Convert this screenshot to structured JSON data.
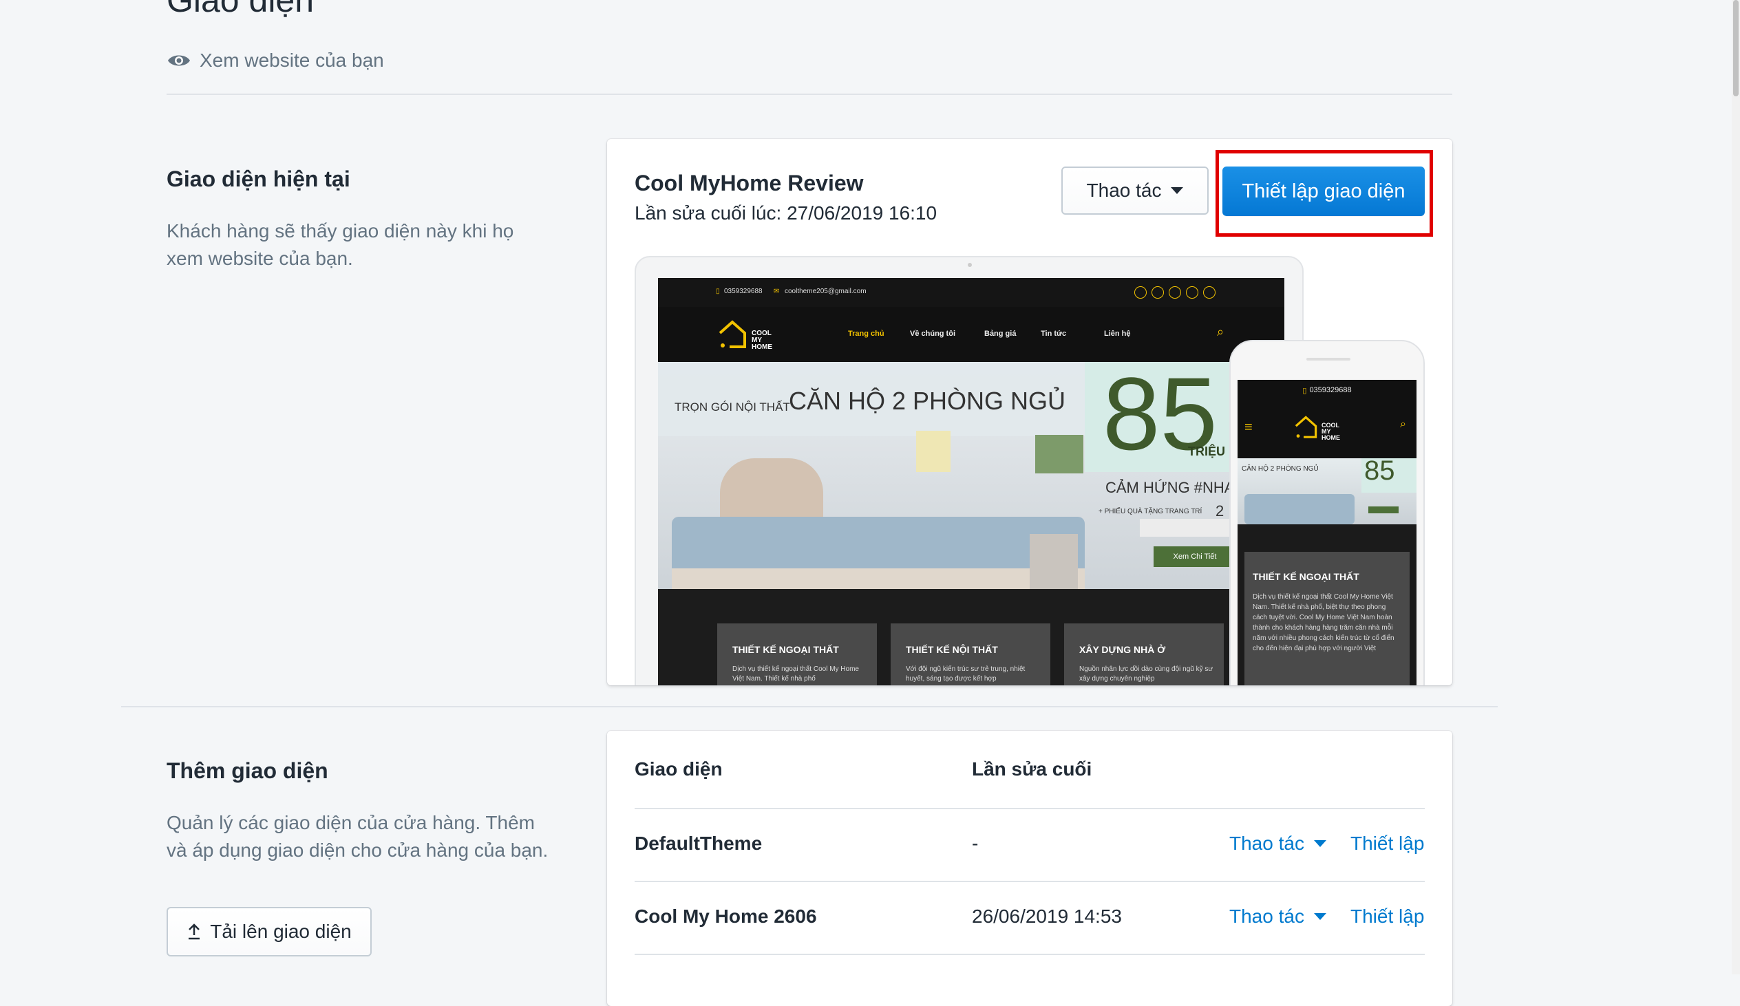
{
  "header": {
    "title": "Giao diện",
    "view_link": "Xem website của bạn",
    "view_icon": "eye-icon"
  },
  "current_section": {
    "title": "Giao diện hiện tại",
    "description": "Khách hàng sẽ thấy giao diện này khi họ xem website của bạn."
  },
  "current_theme": {
    "name": "Cool MyHome Review",
    "last_edited": "Lần sửa cuối lúc: 27/06/2019 16:10",
    "actions_label": "Thao tác",
    "setup_label": "Thiết lập giao diện"
  },
  "preview": {
    "phone": "0359329688",
    "email": "cooltheme205@gmail.com",
    "brand": "COOL MY HOME",
    "nav": [
      "Trang chủ",
      "Về chúng tôi",
      "Bảng giá",
      "Tin tức",
      "Liên hệ"
    ],
    "hero_small": "TRỌN GÓI NỘI THẤT",
    "hero_big": "CĂN HỘ 2 PHÒNG NGỦ",
    "price": "85",
    "price_unit": "TRIỆU",
    "hero_tag": "CẢM HỨNG #NHA",
    "hero_note": "+ PHIẾU QUÀ TẶNG TRANG TRÍ",
    "hero_note_num": "2",
    "cta": "Xem Chi Tiết",
    "tiles": [
      {
        "title": "THIẾT KẾ NGOẠI THẤT",
        "text": "Dịch vụ thiết kế ngoại thất Cool My Home Việt Nam. Thiết kế nhà phố"
      },
      {
        "title": "THIẾT KẾ NỘI THẤT",
        "text": "Với đội ngũ kiến trúc sư trẻ trung, nhiệt huyết, sáng tạo được kết hợp"
      },
      {
        "title": "XÂY DỰNG NHÀ Ở",
        "text": "Nguồn nhân lực dồi dào cùng đội ngũ kỹ sư xây dựng chuyên nghiệp"
      }
    ],
    "mobile_card_title": "THIẾT KẾ NGOẠI THẤT",
    "mobile_card_text": "Dịch vụ thiết kế ngoại thất Cool My Home Việt Nam. Thiết kế nhà phố, biệt thự theo phong cách tuyệt vời. Cool My Home Việt Nam hoàn thành cho khách hàng hàng trăm căn nhà mỗi năm với nhiều phong cách kiến trúc từ cổ điển cho đến hiện đại phù hợp với người Việt"
  },
  "add_section": {
    "title": "Thêm giao diện",
    "description": "Quản lý các giao diện của cửa hàng. Thêm và áp dụng giao diện cho cửa hàng của bạn.",
    "upload_label": "Tải lên giao diện",
    "upload_icon": "upload-icon"
  },
  "themes_table": {
    "columns": [
      "Giao diện",
      "Lần sửa cuối"
    ],
    "rows": [
      {
        "name": "DefaultTheme",
        "edited": "-",
        "actions": "Thao tác",
        "setup": "Thiết lập"
      },
      {
        "name": "Cool My Home 2606",
        "edited": "26/06/2019 14:53",
        "actions": "Thao tác",
        "setup": "Thiết lập"
      }
    ]
  },
  "colors": {
    "primary": "#007ace",
    "highlight": "#e00000",
    "background": "#f4f6f8"
  }
}
